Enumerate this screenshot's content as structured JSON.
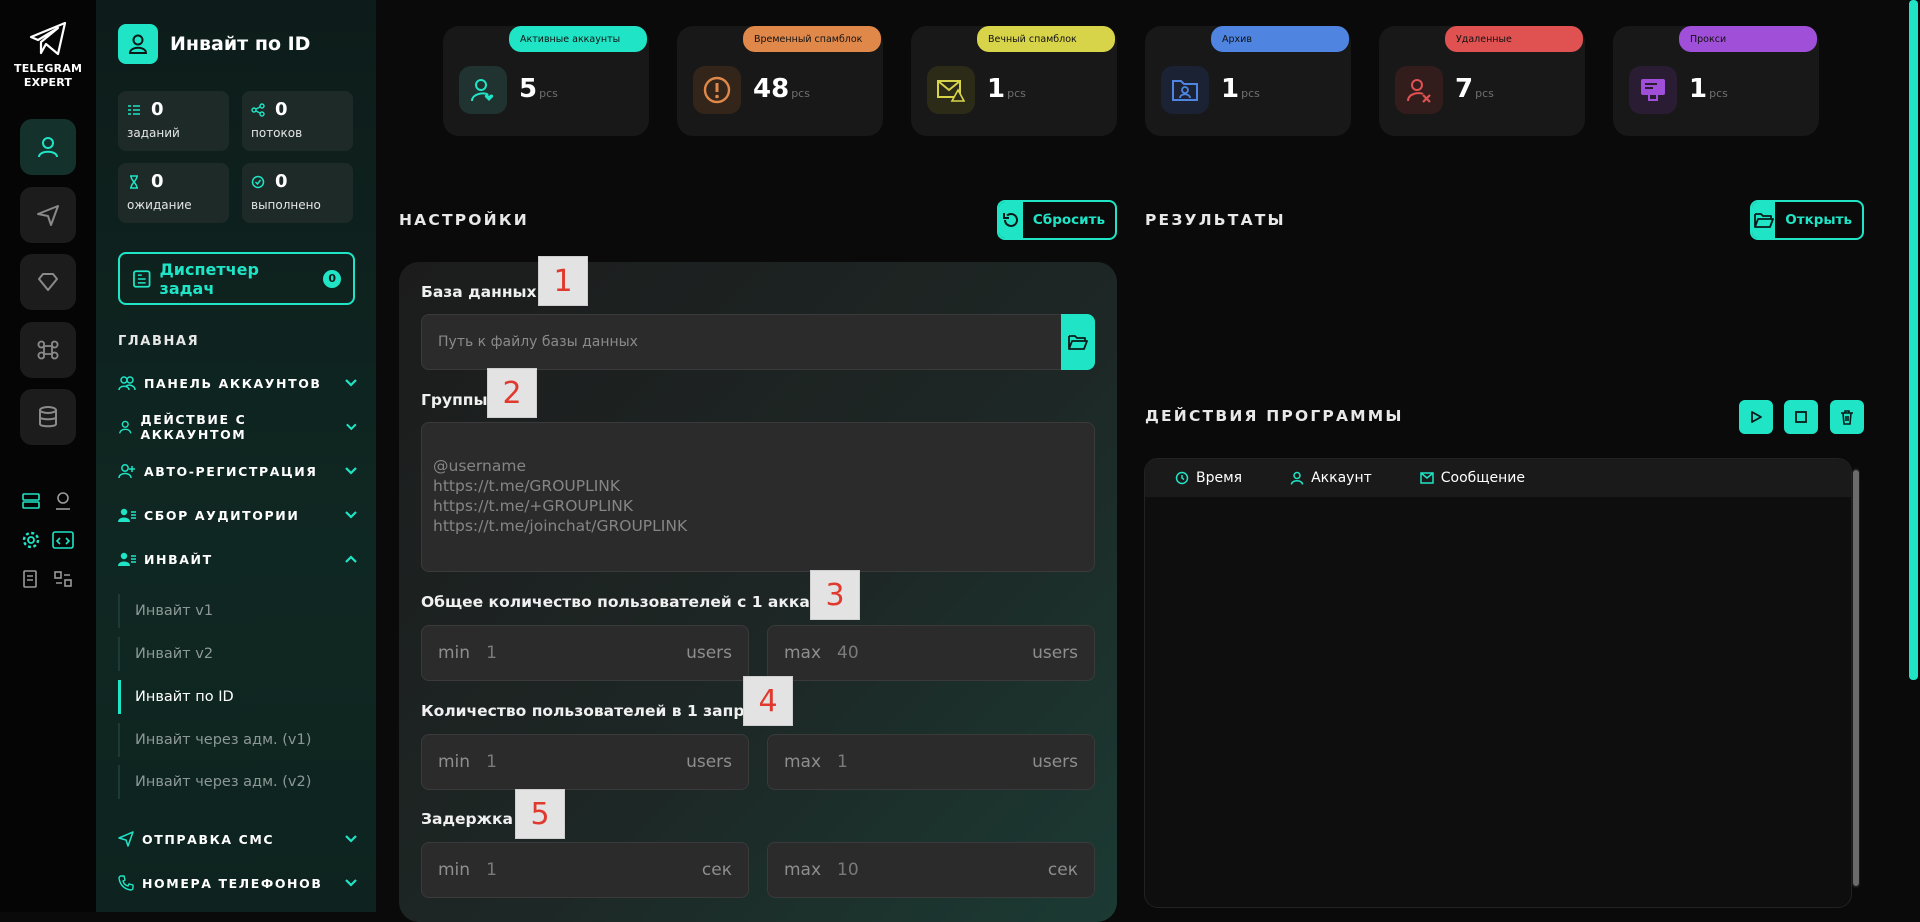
{
  "app": {
    "logo_line1": "TELEGRAM",
    "logo_line2": "EXPERT"
  },
  "sidebar": {
    "title": "Инвайт по ID",
    "stats": [
      {
        "value": "0",
        "label": "заданий"
      },
      {
        "value": "0",
        "label": "потоков"
      },
      {
        "value": "0",
        "label": "ожидание"
      },
      {
        "value": "0",
        "label": "выполнено"
      }
    ],
    "dispatcher": {
      "label": "Диспетчер задач",
      "count": "0"
    },
    "section_title": "ГЛАВНАЯ",
    "nav": [
      {
        "label": "ПАНЕЛЬ АККАУНТОВ"
      },
      {
        "label": "ДЕЙСТВИЕ С АККАУНТОМ"
      },
      {
        "label": "АВТО-РЕГИСТРАЦИЯ"
      },
      {
        "label": "СБОР АУДИТОРИИ"
      },
      {
        "label": "ИНВАЙТ"
      },
      {
        "label": "ОТПРАВКА СМС"
      },
      {
        "label": "НОМЕРА ТЕЛЕФОНОВ"
      }
    ],
    "invite_sub": [
      "Инвайт v1",
      "Инвайт v2",
      "Инвайт по ID",
      "Инвайт через адм. (v1)",
      "Инвайт через адм. (v2)"
    ]
  },
  "cards": [
    {
      "pill": "Активные аккаунты",
      "value": "5",
      "unit": "pcs",
      "color": "#1fe5c6"
    },
    {
      "pill": "Временный спамблок",
      "value": "48",
      "unit": "pcs",
      "color": "#e0884a"
    },
    {
      "pill": "Вечный спамблок",
      "value": "1",
      "unit": "pcs",
      "color": "#d8d44a"
    },
    {
      "pill": "Архив",
      "value": "1",
      "unit": "pcs",
      "color": "#4f84e0"
    },
    {
      "pill": "Удаленные",
      "value": "7",
      "unit": "pcs",
      "color": "#e05252"
    },
    {
      "pill": "Прокси",
      "value": "1",
      "unit": "pcs",
      "color": "#a04fd8"
    }
  ],
  "settings": {
    "title": "НАСТРОЙКИ",
    "reset_label": "Сбросить",
    "db_label": "База данных",
    "db_placeholder": "Путь к файлу базы данных",
    "groups_label": "Группы",
    "groups_placeholder": "@username\nhttps://t.me/GROUPLINK\nhttps://t.me/+GROUPLINK\nhttps://t.me/joinchat/GROUPLINK",
    "total_label": "Общее количество пользователей с 1 аккаунта",
    "per_req_label": "Количество пользователей в 1 запросе",
    "delay_label": "Задержка",
    "min": "min",
    "max": "max",
    "unit_users": "users",
    "unit_sec": "сек",
    "total_min": "1",
    "total_max": "40",
    "req_min": "1",
    "req_max": "1",
    "delay_min": "1",
    "delay_max": "10",
    "badges": [
      "1",
      "2",
      "3",
      "4",
      "5"
    ]
  },
  "results": {
    "title": "РЕЗУЛЬТАТЫ",
    "open_label": "Открыть"
  },
  "actions": {
    "title": "ДЕЙСТВИЯ ПРОГРАММЫ",
    "col_time": "Время",
    "col_account": "Аккаунт",
    "col_message": "Сообщение"
  },
  "colors": {
    "accent": "#1fe5c6",
    "bg": "#0a0a0a"
  }
}
